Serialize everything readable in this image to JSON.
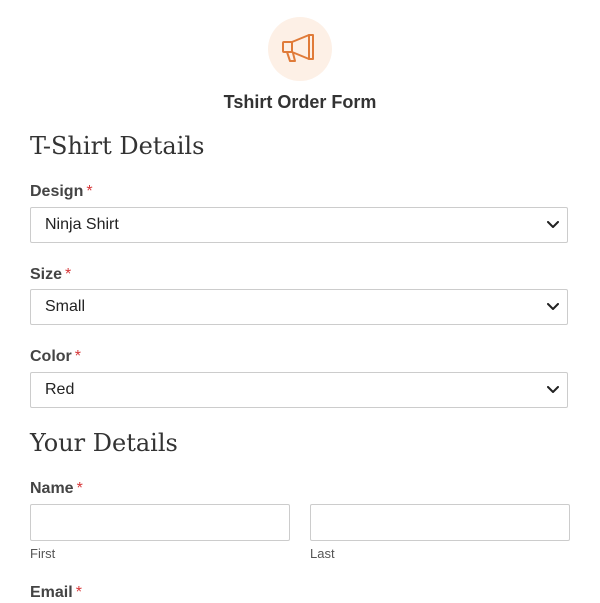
{
  "header": {
    "icon": "megaphone-icon",
    "title": "Tshirt Order Form",
    "accent_color": "#e07b39",
    "icon_bg_color": "#fdf0e6"
  },
  "sections": {
    "tshirt_details": {
      "heading": "T-Shirt Details",
      "design": {
        "label": "Design",
        "required_mark": "*",
        "value": "Ninja Shirt"
      },
      "size": {
        "label": "Size",
        "required_mark": "*",
        "value": "Small"
      },
      "color": {
        "label": "Color",
        "required_mark": "*",
        "value": "Red"
      }
    },
    "your_details": {
      "heading": "Your Details",
      "name": {
        "label": "Name",
        "required_mark": "*",
        "first_sublabel": "First",
        "last_sublabel": "Last",
        "first_value": "",
        "last_value": ""
      },
      "email": {
        "label": "Email",
        "required_mark": "*"
      }
    }
  },
  "required_color": "#d63638"
}
